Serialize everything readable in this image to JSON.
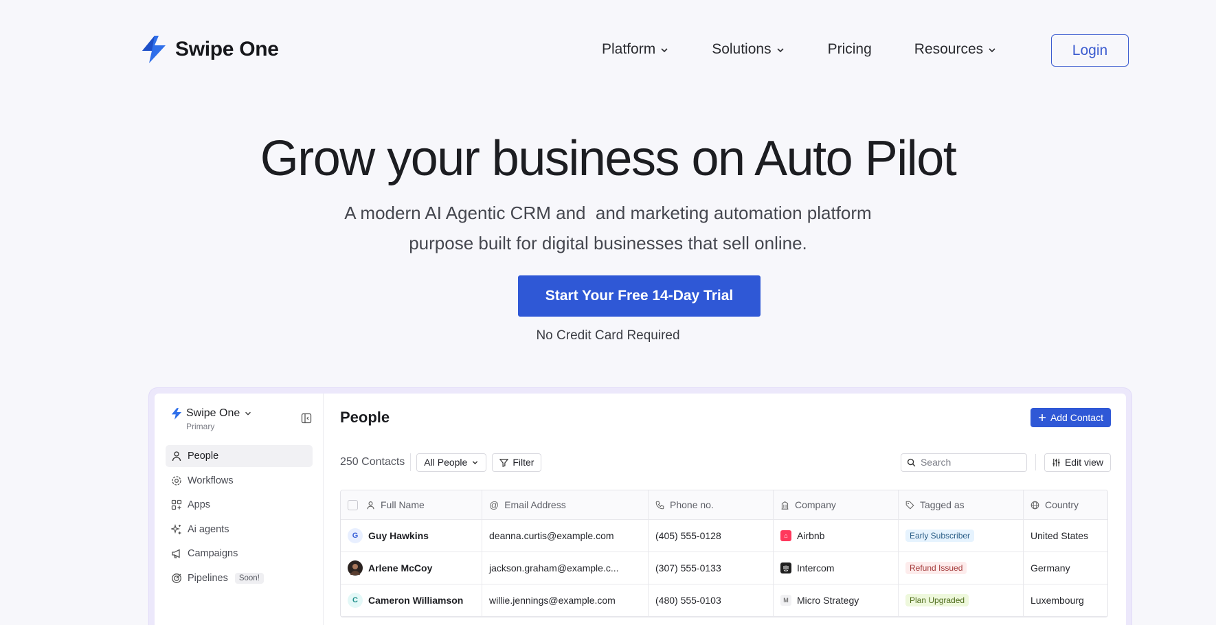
{
  "brand": {
    "name": "Swipe One",
    "accent": "#2f58d6"
  },
  "nav": {
    "items": [
      {
        "label": "Platform",
        "has_menu": true
      },
      {
        "label": "Solutions",
        "has_menu": true
      },
      {
        "label": "Pricing",
        "has_menu": false
      },
      {
        "label": "Resources",
        "has_menu": true
      }
    ],
    "login_label": "Login"
  },
  "hero": {
    "title": "Grow your business on Auto Pilot",
    "subtitle_line1": "A modern AI Agentic CRM and  and marketing automation platform",
    "subtitle_line2": "purpose built for digital businesses that sell online.",
    "cta_label": "Start Your Free 14-Day Trial",
    "cta_note": "No Credit Card Required"
  },
  "app": {
    "workspace": {
      "name": "Swipe One",
      "subtitle": "Primary"
    },
    "sidebar": [
      {
        "label": "People",
        "icon": "user-icon",
        "active": true
      },
      {
        "label": "Workflows",
        "icon": "workflow-gear-icon",
        "active": false
      },
      {
        "label": "Apps",
        "icon": "apps-grid-icon",
        "active": false
      },
      {
        "label": "Ai agents",
        "icon": "sparkle-icon",
        "active": false
      },
      {
        "label": "Campaigns",
        "icon": "megaphone-icon",
        "active": false
      },
      {
        "label": "Pipelines",
        "icon": "target-icon",
        "active": false,
        "badge": "Soon!"
      }
    ],
    "page_title": "People",
    "add_contact_label": "Add Contact",
    "toolbar": {
      "count": "250 Contacts",
      "view_select": "All People",
      "filter_label": "Filter",
      "search_placeholder": "Search",
      "edit_view_label": "Edit view"
    },
    "table": {
      "columns": [
        "Full Name",
        "Email Address",
        "Phone no.",
        "Company",
        "Tagged as",
        "Country"
      ],
      "rows": [
        {
          "initial": "G",
          "name": "Guy Hawkins",
          "email": "deanna.curtis@example.com",
          "phone": "(405) 555-0128",
          "company": "Airbnb",
          "tag": "Early Subscriber",
          "country": "United States"
        },
        {
          "initial": "",
          "name": "Arlene McCoy",
          "email": "jackson.graham@example.c...",
          "phone": "(307) 555-0133",
          "company": "Intercom",
          "tag": "Refund Issued",
          "country": "Germany"
        },
        {
          "initial": "C",
          "name": "Cameron Williamson",
          "email": "willie.jennings@example.com",
          "phone": "(480) 555-0103",
          "company": "Micro Strategy",
          "tag": "Plan Upgraded",
          "country": "Luxembourg"
        }
      ]
    }
  }
}
